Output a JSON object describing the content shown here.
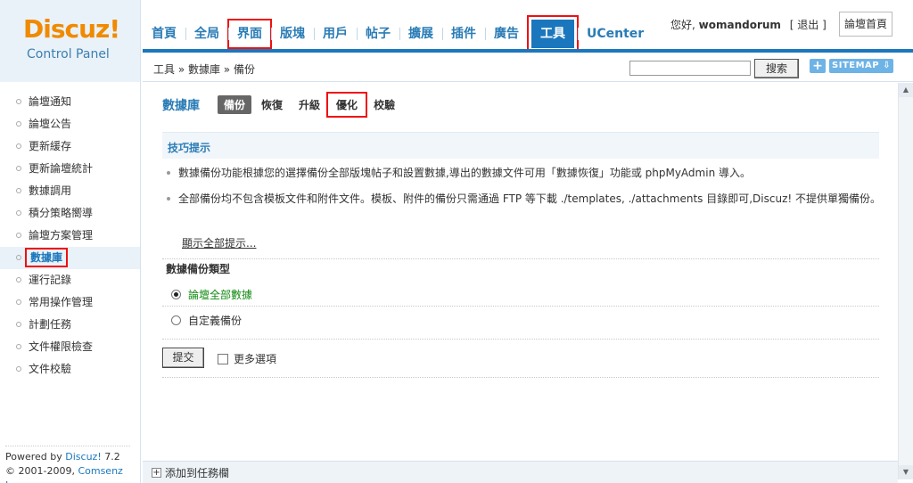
{
  "brand": {
    "logo": "Discuz!",
    "subtitle": "Control Panel"
  },
  "nav": {
    "items": [
      {
        "label": "首頁"
      },
      {
        "label": "全局"
      },
      {
        "label": "界面"
      },
      {
        "label": "版塊"
      },
      {
        "label": "用戶"
      },
      {
        "label": "帖子"
      },
      {
        "label": "擴展"
      },
      {
        "label": "插件"
      },
      {
        "label": "廣告"
      },
      {
        "label": "工具"
      },
      {
        "label": "UCenter"
      }
    ],
    "active": "工具"
  },
  "user": {
    "greeting": "您好,",
    "name": "womandorum",
    "logout": "[ 退出 ]",
    "home": "論壇首頁"
  },
  "breadcrumb": "工具 » 數據庫 » 備份",
  "search": {
    "button": "搜索",
    "plus": "+",
    "sitemap": "SITEMAP ⇩"
  },
  "sidebar": {
    "items": [
      {
        "label": "論壇通知"
      },
      {
        "label": "論壇公告"
      },
      {
        "label": "更新緩存"
      },
      {
        "label": "更新論壇統計"
      },
      {
        "label": "數據調用"
      },
      {
        "label": "積分策略嚮導"
      },
      {
        "label": "論壇方案管理"
      },
      {
        "label": "數據庫"
      },
      {
        "label": "運行記錄"
      },
      {
        "label": "常用操作管理"
      },
      {
        "label": "計劃任務"
      },
      {
        "label": "文件權限檢查"
      },
      {
        "label": "文件校驗"
      }
    ],
    "active": "數據庫",
    "powered_prefix": "Powered by ",
    "powered_brand": "Discuz!",
    "powered_version": " 7.2",
    "copyright_prefix": "© 2001-2009, ",
    "copyright_brand": "Comsenz Inc."
  },
  "main": {
    "section_title": "數據庫",
    "tabs": [
      {
        "label": "備份"
      },
      {
        "label": "恢復"
      },
      {
        "label": "升級"
      },
      {
        "label": "優化"
      },
      {
        "label": "校驗"
      }
    ],
    "active_tab": "備份",
    "tips_title": "技巧提示",
    "tip1": "數據備份功能根據您的選擇備份全部版塊帖子和設置數據,導出的數據文件可用「數據恢復」功能或 phpMyAdmin 導入。",
    "tip2": "全部備份均不包含模板文件和附件文件。模板、附件的備份只需通過 FTP 等下載 ./templates, ./attachments 目錄即可,Discuz! 不提供單獨備份。",
    "show_all": "顯示全部提示...",
    "type_title": "數據備份類型",
    "options": [
      {
        "label": "論壇全部數據",
        "checked": true
      },
      {
        "label": "自定義備份",
        "checked": false
      }
    ],
    "submit": "提交",
    "more_options": "更多選項"
  },
  "footer": {
    "add_task": "添加到任務欄"
  }
}
